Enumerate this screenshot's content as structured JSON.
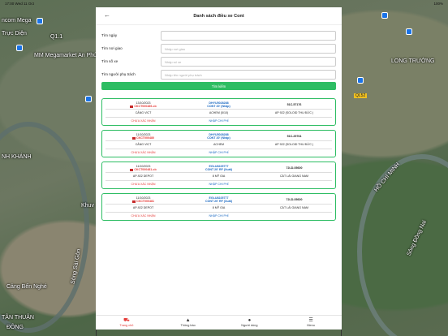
{
  "status_bar": {
    "time": "17:00",
    "date": "Wed 11 Oct",
    "battery": "100%"
  },
  "map_labels": [
    "ncom Mega",
    "Trực Diện",
    "MM Megamarket An Phú",
    "Q1.1",
    "LONG TRƯỜNG",
    "NH KHÁNH",
    "Cảng Bến Nghé",
    "TÂN THUẬN",
    "ĐÔNG",
    "Khuv",
    "HỒ CHÍ MINH",
    "Sông Đồng Nai",
    "Sông Sài Gòn",
    "QL52"
  ],
  "header": {
    "title": "Danh sách điều xe Cont",
    "back_icon": "←"
  },
  "search": {
    "fields": [
      {
        "label": "Tìm ngày",
        "placeholder": ""
      },
      {
        "label": "Tìm nơi giao",
        "placeholder": "Nhập nơi giao"
      },
      {
        "label": "Tìm số xe",
        "placeholder": "Nhập số xe"
      },
      {
        "label": "Tìm người phụ trách",
        "placeholder": "Nhập tên người phụ trách"
      }
    ],
    "button_label": "Tìm kiếm"
  },
  "orders": [
    {
      "date": "13/10/2023",
      "code": "CKCT000489-cb",
      "booking": "DHYU5028288",
      "cont": "CONT 20' (Nhập)",
      "plate": "51C-57176",
      "from": "CẢNG VICT",
      "via": "ACHEM (5/10)",
      "to": "AP 922 (SOLOID THU ĐỨC )",
      "status": "CHƯA XÁC NHẬN",
      "fee": "NHẬP CHI PHÍ"
    },
    {
      "date": "11/10/2023",
      "code": "CKCT000480",
      "booking": "DHYU5028288",
      "cont": "CONT 20' (Nhập)",
      "plate": "51C-29764",
      "from": "CẢNG VICT",
      "via": "ACHEM",
      "to": "AP 922 (SOLOID THU ĐỨC )",
      "status": "CHƯA XÁC NHẬN",
      "fee": "NHẬP CHI PHÍ"
    },
    {
      "date": "11/10/2023",
      "code": "CKCT000481-cb",
      "booking": "EGLU8225777",
      "cont": "CONT 20' RF (Xuất)",
      "plate": "72LD-05600",
      "from": "AP-922 DEPOT",
      "via": "8 MỸ GIA",
      "to": "CÁT LÁI GIANG NAM",
      "status": "CHƯA XÁC NHẬN",
      "fee": "NHẬP CHI PHÍ"
    },
    {
      "date": "11/10/2023",
      "code": "CKCT000481",
      "booking": "EGLU8225777",
      "cont": "CONT 20' RF (Xuất)",
      "plate": "72LD-05600",
      "from": "AP-922 DEPOT",
      "via": "8 MỸ GIA",
      "to": "CÁT LÁI GIANG NAM",
      "status": "CHƯA XÁC NHẬN",
      "fee": "NHẬP CHI PHÍ"
    }
  ],
  "bottom_nav": [
    {
      "label": "Trang chủ",
      "icon": "truck-icon"
    },
    {
      "label": "Thông báo",
      "icon": "bell-icon"
    },
    {
      "label": "Người dùng",
      "icon": "user-icon"
    },
    {
      "label": "Menu",
      "icon": "menu-icon"
    }
  ]
}
